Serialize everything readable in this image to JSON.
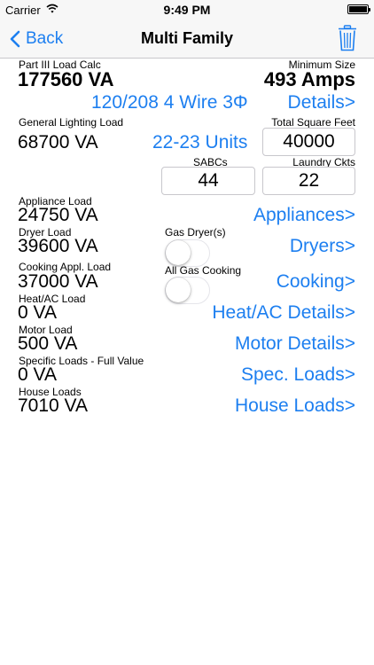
{
  "status_bar": {
    "carrier": "Carrier",
    "time": "9:49 PM"
  },
  "nav": {
    "back_label": "Back",
    "title": "Multi Family"
  },
  "colors": {
    "accent": "#1d7ff0",
    "bar_bg": "#f7f7f7"
  },
  "summary": {
    "calc_label": "Part III Load Calc",
    "calc_value": "177560 VA",
    "min_size_label": "Minimum Size",
    "min_size_value": "493 Amps",
    "service_link": "120/208 4 Wire 3Φ",
    "details_link": "Details>"
  },
  "general": {
    "lighting_label": "General Lighting Load",
    "lighting_value": "68700 VA",
    "units_link": "22-23 Units",
    "sqft_label": "Total Square Feet",
    "sqft_value": "40000",
    "sabcs_label": "SABCs",
    "sabcs_value": "44",
    "laundry_label": "Laundry Ckts",
    "laundry_value": "22"
  },
  "loads": [
    {
      "label": "Appliance Load",
      "value": "24750 VA",
      "link": "Appliances>"
    },
    {
      "label": "Dryer Load",
      "value": "39600 VA",
      "link": "Dryers>"
    },
    {
      "label": "Cooking Appl. Load",
      "value": "37000 VA",
      "link": "Cooking>"
    },
    {
      "label": "Heat/AC Load",
      "value": "0 VA",
      "link": "Heat/AC Details>"
    },
    {
      "label": "Motor Load",
      "value": "500 VA",
      "link": "Motor Details>"
    },
    {
      "label": "Specific Loads - Full Value",
      "value": "0 VA",
      "link": "Spec. Loads>"
    },
    {
      "label": "House Loads",
      "value": "7010 VA",
      "link": "House Loads>"
    }
  ],
  "toggles": {
    "gas_dryer_label": "Gas Dryer(s)",
    "gas_dryer_on": false,
    "gas_cooking_label": "All Gas Cooking",
    "gas_cooking_on": false
  }
}
